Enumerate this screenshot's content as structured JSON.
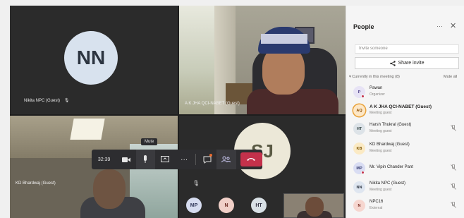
{
  "stage": {
    "tiles": {
      "nn": {
        "initials": "NN",
        "label": "Nikita NPC (Guest)"
      },
      "ak": {
        "label": "A K JHA QCI-NABET (Guest)"
      },
      "kd": {
        "label": "KD Bhardwaj (Guest)"
      },
      "sj": {
        "initials": "SJ"
      }
    },
    "mini_avatars": [
      "MP",
      "N",
      "HT"
    ],
    "controls": {
      "timer": "32:39",
      "tooltip": "Mute",
      "camera_icon": "camera-icon",
      "mic_icon": "microphone-icon",
      "share_icon": "share-screen-icon",
      "more_icon": "more-icon",
      "chat_icon": "chat-icon",
      "people_icon": "people-icon",
      "hangup_icon": "hang-up-icon",
      "hangup_color": "#c4314b"
    }
  },
  "panel": {
    "title": "People",
    "more": "···",
    "close": "✕",
    "invite_placeholder": "Invite someone",
    "share_label": "Share invite",
    "section_title": "Currently in this meeting (8)",
    "mute_all": "Mute all",
    "people": [
      {
        "initials": "P",
        "name": "Pawan",
        "role": "Organizer",
        "muted": false,
        "avatar_bg": "#e7e3f5",
        "avatar_fg": "#4b3e86",
        "status": true
      },
      {
        "initials": "AQ",
        "name": "A K JHA QCI-NABET (Guest)",
        "role": "Meeting guest",
        "muted": false,
        "avatar_bg": "#fde7c6",
        "avatar_fg": "#8a4b00",
        "bold": true,
        "speaking": true
      },
      {
        "initials": "HT",
        "name": "Harsh Thukral (Guest)",
        "role": "Meeting guest",
        "muted": true,
        "avatar_bg": "#dde3e8",
        "avatar_fg": "#344"
      },
      {
        "initials": "KB",
        "name": "KD Bhardwaj (Guest)",
        "role": "Meeting guest",
        "muted": false,
        "avatar_bg": "#fbeac4",
        "avatar_fg": "#7a5200"
      },
      {
        "initials": "MP",
        "name": "Mr. Vipin Chander Pant",
        "role": "",
        "muted": true,
        "avatar_bg": "#d9ddf3",
        "avatar_fg": "#333a6c",
        "status": true
      },
      {
        "initials": "NN",
        "name": "Nikita NPC (Guest)",
        "role": "Meeting guest",
        "muted": true,
        "avatar_bg": "#dfe6f0",
        "avatar_fg": "#2c3440"
      },
      {
        "initials": "N",
        "name": "NPC16",
        "role": "External",
        "muted": true,
        "avatar_bg": "#f6d6cf",
        "avatar_fg": "#7a2c22"
      }
    ]
  }
}
